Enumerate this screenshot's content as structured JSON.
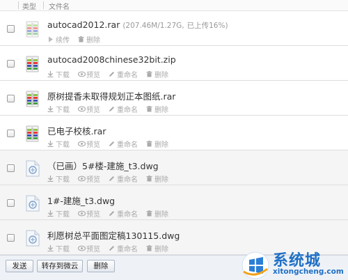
{
  "header": {
    "type_label": "类型",
    "name_label": "文件名"
  },
  "files": [
    {
      "name": "autocad2012.rar",
      "meta": "(207.46M/1.27G,",
      "progress": "已上传16%)",
      "kind": "archive-uploading",
      "actions": [
        "续传",
        "删除"
      ]
    },
    {
      "name": "autocad2008chinese32bit.zip",
      "kind": "archive",
      "actions": [
        "下载",
        "预览",
        "重命名",
        "删除"
      ]
    },
    {
      "name": "原树提香未取得规划正本图纸.rar",
      "kind": "archive",
      "actions": [
        "下载",
        "预览",
        "重命名",
        "删除"
      ]
    },
    {
      "name": "已电子校核.rar",
      "kind": "archive",
      "actions": [
        "下载",
        "预览",
        "重命名",
        "删除"
      ]
    },
    {
      "name": "（已画）5#楼-建施_t3.dwg",
      "kind": "dwg",
      "actions": [
        "下载",
        "预览",
        "重命名",
        "删除"
      ]
    },
    {
      "name": "1#-建施_t3.dwg",
      "kind": "dwg",
      "actions": [
        "下载",
        "预览",
        "重命名",
        "删除"
      ]
    },
    {
      "name": "利愿树总平面图定稿130115.dwg",
      "kind": "dwg",
      "actions": [
        "下载",
        "预览",
        "重命名",
        "删除"
      ]
    }
  ],
  "toolbar": {
    "send_label": "发送",
    "save_label": "转存到微云",
    "delete_label": "删除"
  },
  "watermark": {
    "brand": "系统城",
    "url": "xitongcheng.com"
  },
  "colors": {
    "accent": "#1f6fc5",
    "progress": "#dd3333"
  }
}
